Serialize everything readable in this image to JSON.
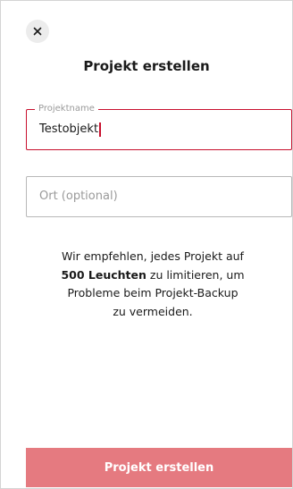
{
  "header": {
    "title": "Projekt erstellen",
    "close_icon": "close-icon"
  },
  "form": {
    "name_field": {
      "label": "Projektname",
      "value": "Testobjekt",
      "state": "focused",
      "accent_color": "#c8102e"
    },
    "location_field": {
      "placeholder": "Ort (optional)",
      "value": ""
    }
  },
  "info": {
    "line_1": "Wir empfehlen, jedes Projekt auf",
    "highlight": "500 Leuchten",
    "line_2_rest": " zu limitieren, um",
    "line_3": "Probleme beim Projekt-Backup",
    "line_4": "zu vermeiden."
  },
  "submit": {
    "label": "Projekt erstellen",
    "color": "#e57a80"
  }
}
